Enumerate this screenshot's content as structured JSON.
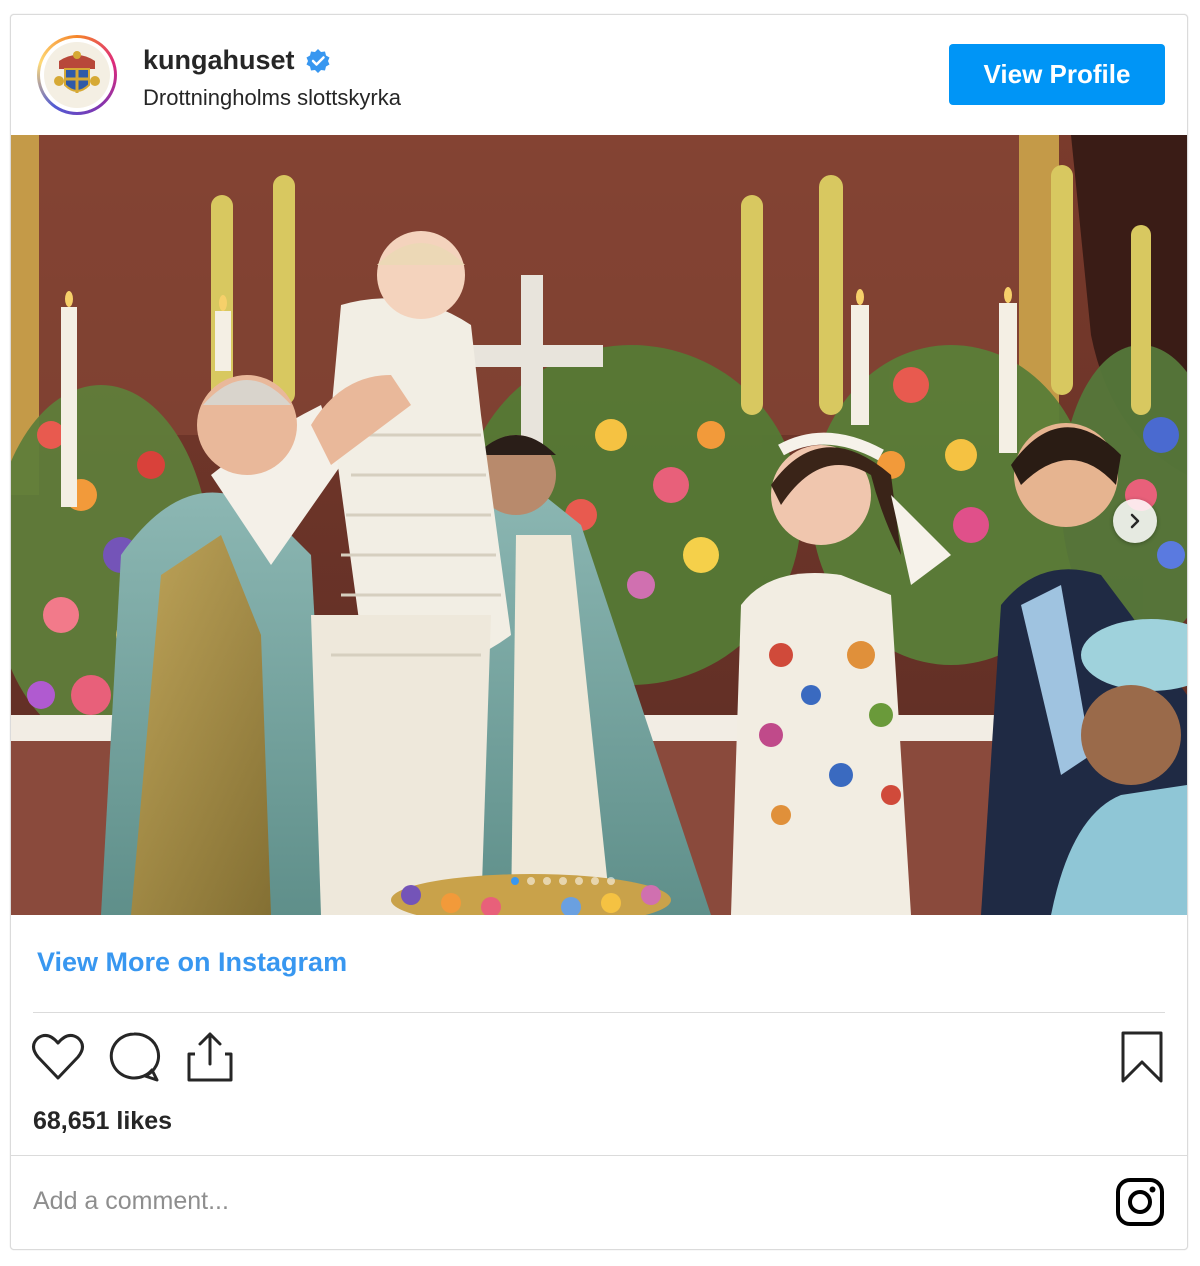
{
  "header": {
    "username": "kungahuset",
    "location": "Drottningholms slottskyrka",
    "view_profile_label": "View Profile"
  },
  "post": {
    "image_icon": "next-arrow-icon",
    "carousel": {
      "count": 7,
      "active_index": 0
    }
  },
  "footer": {
    "view_more_label": "View More on Instagram",
    "likes_text": "68,651 likes",
    "comment_placeholder": "Add a comment..."
  },
  "colors": {
    "accent": "#0095f6",
    "link": "#3897f0",
    "text": "#262626",
    "muted": "#8e8e8e",
    "border": "#dbdbdb"
  },
  "icons": [
    "verified-badge-icon",
    "heart-icon",
    "comment-icon",
    "share-icon",
    "bookmark-icon",
    "instagram-logo-icon",
    "coat-of-arms-icon"
  ]
}
